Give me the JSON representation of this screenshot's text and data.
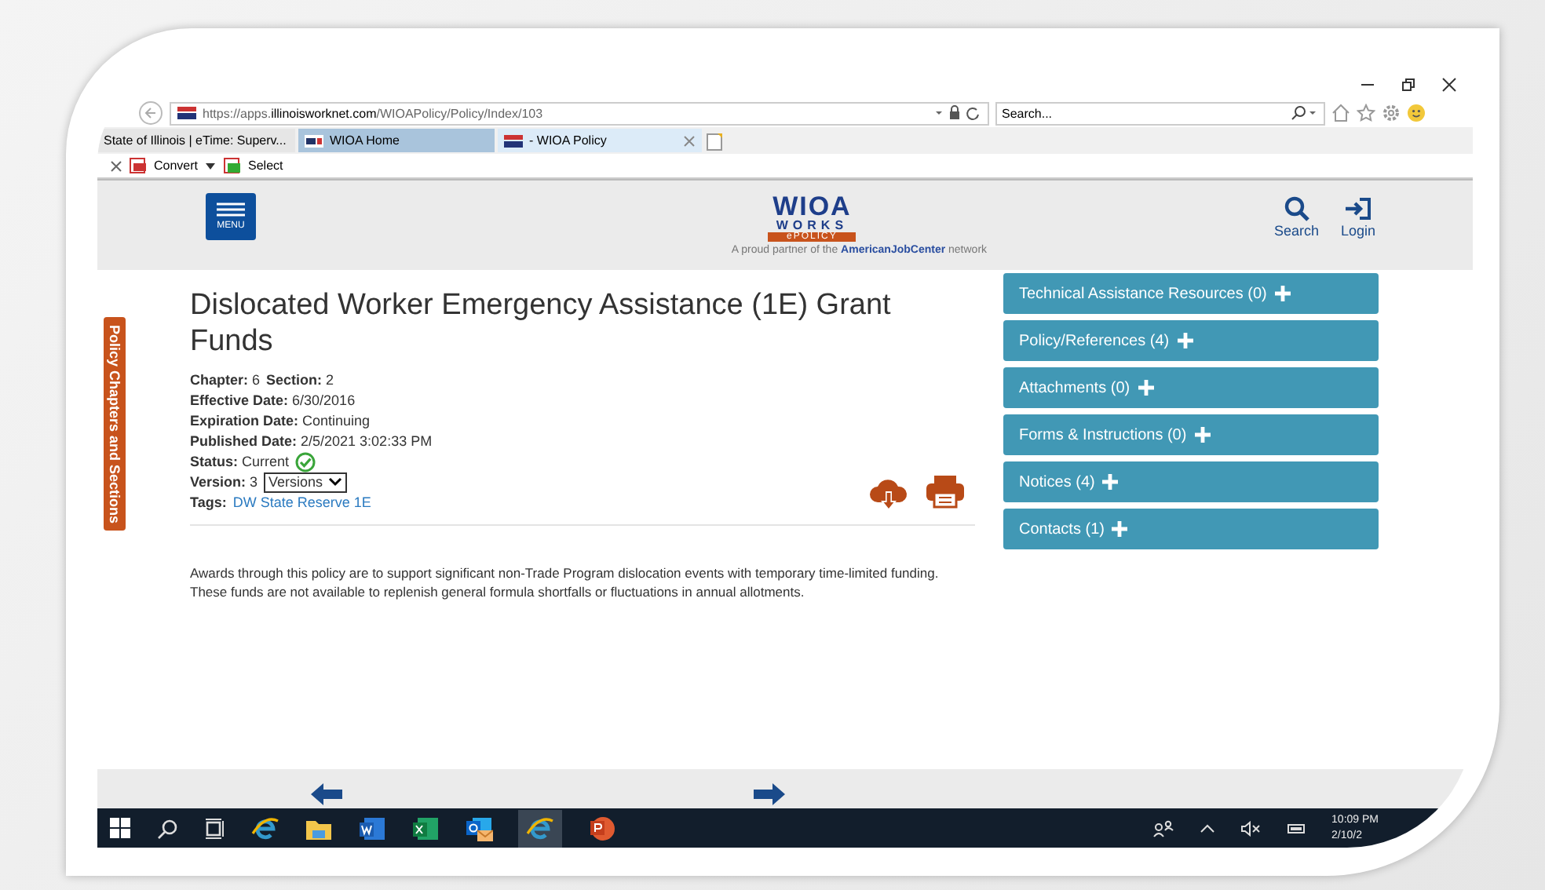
{
  "browser": {
    "url": {
      "scheme": "https://apps.",
      "domain": "illinoisworknet.com",
      "path": "/WIOAPolicy/Policy/Index/103"
    },
    "search": {
      "placeholder": "Search..."
    },
    "tabs": [
      {
        "label": "State of Illinois | eTime: Superv...",
        "selected": false
      },
      {
        "label": "WIOA Home",
        "selected": false
      },
      {
        "label": "- WIOA Policy",
        "selected": true
      }
    ],
    "command_bar": [
      "Convert",
      "Select"
    ]
  },
  "header": {
    "menu": "MENU",
    "logo": {
      "word": "WIOA",
      "works": "WORKS",
      "epolicy": "ePOLICY"
    },
    "tagline": "A proud partner of the **AmericanJobCenter** network",
    "actions": [
      "Search",
      "Login"
    ]
  },
  "side_tab": "Policy Chapters and Sections",
  "policy": {
    "title": "Dislocated Worker Emergency Assistance (1E) Grant Funds",
    "meta": [
      [
        {
          "label": "Chapter:",
          "value": "6"
        },
        {
          "label": "Section:",
          "value": "2"
        }
      ],
      [
        {
          "label": "Effective Date:",
          "value": "6/30/2016"
        }
      ],
      [
        {
          "label": "Expiration Date:",
          "value": "Continuing"
        }
      ],
      [
        {
          "label": "Published Date:",
          "value": "2/5/2021 3:02:33 PM"
        }
      ]
    ],
    "status": {
      "label": "Status:",
      "value": "Current"
    },
    "version": {
      "label": "Version:",
      "value": "3",
      "select": "Versions"
    },
    "tags": {
      "label": "Tags:",
      "value": "DW State Reserve 1E"
    },
    "body": "Awards through this policy are to support significant non-Trade Program dislocation events with temporary time-limited funding.  These funds are not available to replenish general formula shortfalls or fluctuations in annual allotments."
  },
  "panels": [
    "Technical Assistance Resources (0)",
    "Policy/References (4)",
    "Attachments (0)",
    "Forms & Instructions (0)",
    "Notices (4)",
    "Contacts (1)"
  ],
  "taskbar": {
    "time": "10:09 PM",
    "date": "2/10/2"
  }
}
